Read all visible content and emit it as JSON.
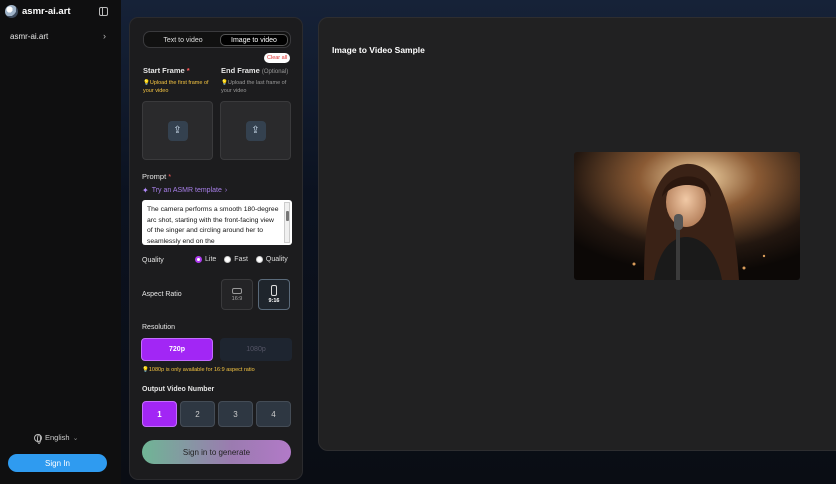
{
  "app": {
    "name": "asmr-ai.art"
  },
  "sidebar": {
    "items": [
      {
        "label": "asmr-ai.art"
      }
    ],
    "language": "English",
    "signin_label": "Sign In"
  },
  "form": {
    "tabs": [
      {
        "label": "Text to video",
        "active": false
      },
      {
        "label": "Image to video",
        "active": true
      }
    ],
    "start_frame": {
      "label": "Start Frame",
      "required_mark": "*",
      "hint": "Upload the first frame of your video"
    },
    "end_frame": {
      "label": "End Frame",
      "optional": "(Optional)",
      "hint": "Upload the last frame of your video"
    },
    "clear_all_label": "Clear all",
    "prompt": {
      "label": "Prompt",
      "required_mark": "*",
      "template_link": "Try an ASMR template",
      "value": "The camera performs a smooth 180-degree arc shot, starting with the front-facing view of the singer and circling around her to seamlessly end on the"
    },
    "quality": {
      "label": "Quality",
      "options": [
        "Lite",
        "Fast",
        "Quality"
      ],
      "selected": "Lite"
    },
    "aspect_ratio": {
      "label": "Aspect Ratio",
      "options": [
        "16:9",
        "9:16"
      ],
      "selected": "9:16"
    },
    "resolution": {
      "label": "Resolution",
      "options": [
        "720p",
        "1080p"
      ],
      "selected": "720p",
      "hint": "1080p is only available for 16:9 aspect ratio"
    },
    "output_number": {
      "label": "Output Video Number",
      "options": [
        "1",
        "2",
        "3",
        "4"
      ],
      "selected": "1"
    },
    "generate_label": "Sign in to generate"
  },
  "preview": {
    "title": "Image to Video Sample"
  },
  "colors": {
    "accent": "#a226f5",
    "signin": "#2f9bf0",
    "hint_yellow": "#f5c542",
    "template_link": "#a77fe8"
  }
}
